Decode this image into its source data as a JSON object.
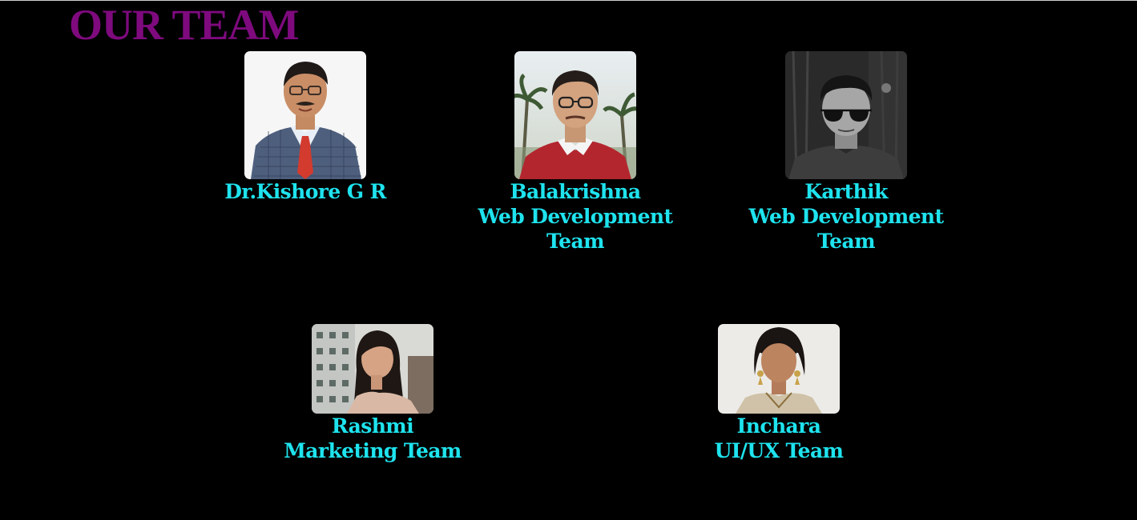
{
  "title": "OUR TEAM",
  "colors": {
    "background": "#000000",
    "title": "#7e0a7e",
    "member_text": "#1ee3ee"
  },
  "members": [
    {
      "name": "Dr.Kishore G R",
      "role_line1": "",
      "role_line2": ""
    },
    {
      "name": "Balakrishna",
      "role_line1": "Web Development",
      "role_line2": "Team"
    },
    {
      "name": "Karthik",
      "role_line1": "Web Development",
      "role_line2": "Team"
    },
    {
      "name": "Rashmi",
      "role_line1": "Marketing Team",
      "role_line2": ""
    },
    {
      "name": "Inchara",
      "role_line1": "UI/UX Team",
      "role_line2": ""
    }
  ]
}
